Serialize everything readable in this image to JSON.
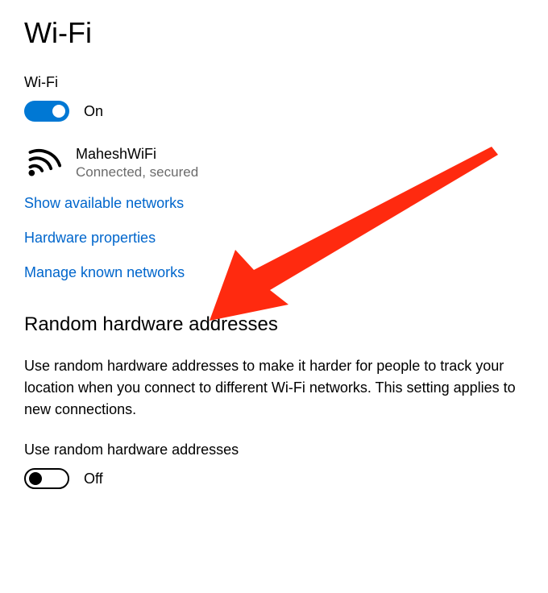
{
  "page": {
    "title": "Wi-Fi"
  },
  "wifi_toggle": {
    "label": "Wi-Fi",
    "state": "on",
    "state_label": "On"
  },
  "current_network": {
    "name": "MaheshWiFi",
    "status": "Connected, secured"
  },
  "links": {
    "available_networks": "Show available networks",
    "hardware_properties": "Hardware properties",
    "manage_known_networks": "Manage known networks"
  },
  "random_hw": {
    "heading": "Random hardware addresses",
    "description": "Use random hardware addresses to make it harder for people to track your location when you connect to different Wi-Fi networks. This setting applies to new connections.",
    "toggle_label": "Use random hardware addresses",
    "state": "off",
    "state_label": "Off"
  },
  "annotation": {
    "arrow_color": "#ff2a0f"
  }
}
